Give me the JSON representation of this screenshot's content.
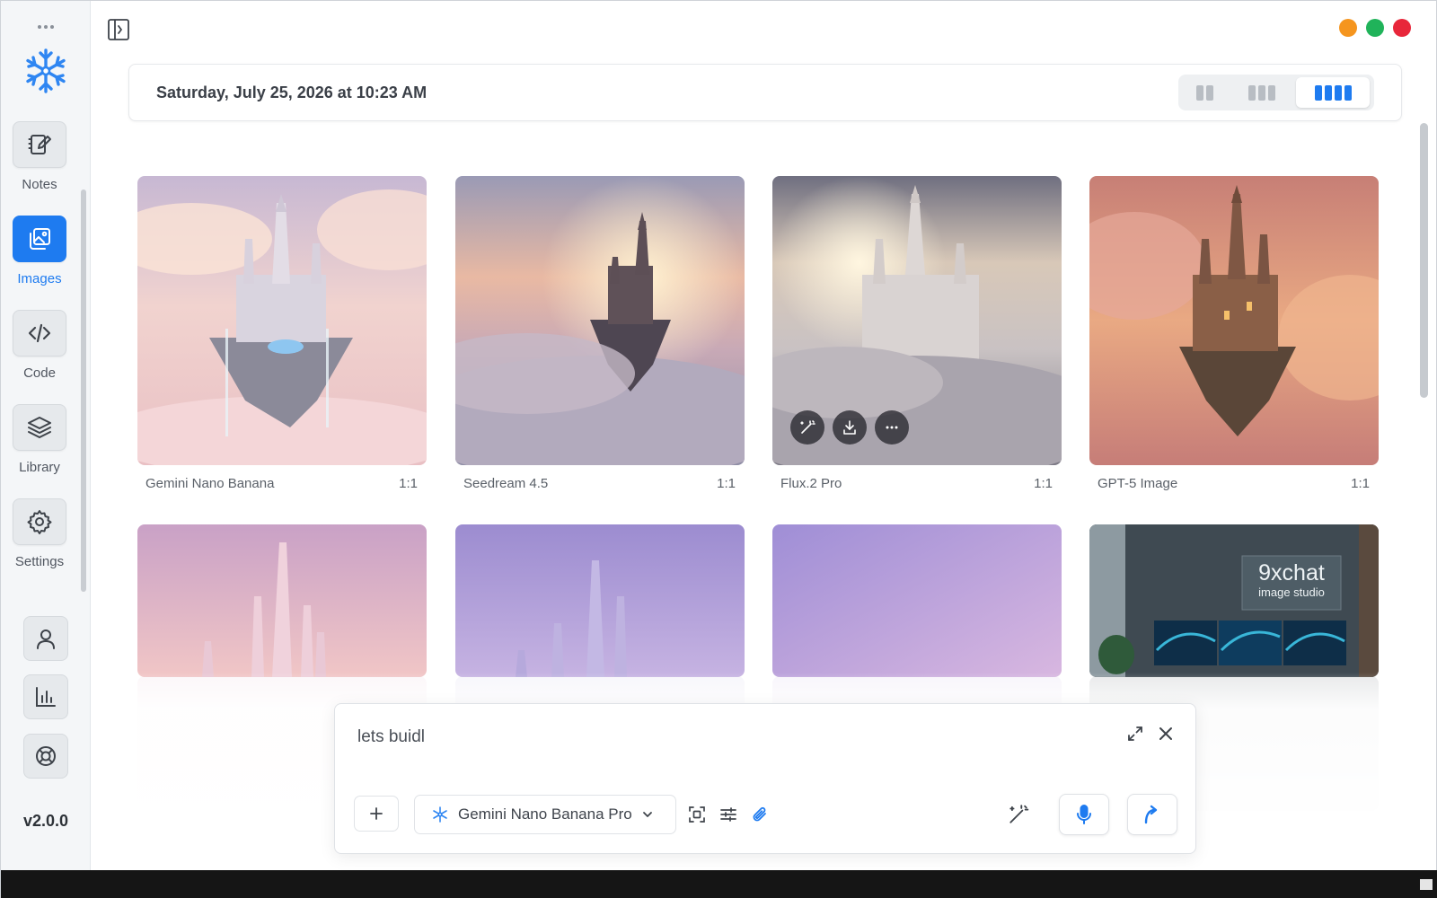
{
  "sidebar": {
    "items": [
      {
        "label": "Notes",
        "icon": "notes-icon",
        "active": false
      },
      {
        "label": "Images",
        "icon": "images-icon",
        "active": true
      },
      {
        "label": "Code",
        "icon": "code-icon",
        "active": false
      },
      {
        "label": "Library",
        "icon": "layers-icon",
        "active": false
      },
      {
        "label": "Settings",
        "icon": "gear-icon",
        "active": false
      }
    ],
    "utilities": [
      "user-icon",
      "chart-icon",
      "lifebuoy-icon"
    ],
    "version": "v2.0.0"
  },
  "header": {
    "date": "Saturday, July 25, 2026 at 10:23 AM",
    "layout_options": [
      "2-column",
      "3-column",
      "4-column"
    ],
    "selected_layout": "4-column"
  },
  "window_controls": {
    "colors": [
      "#f5951e",
      "#20b35a",
      "#e8263a"
    ]
  },
  "gallery": {
    "row1": [
      {
        "model": "Gemini Nano Banana",
        "ratio": "1:1"
      },
      {
        "model": "Seedream 4.5",
        "ratio": "1:1"
      },
      {
        "model": "Flux.2 Pro",
        "ratio": "1:1"
      },
      {
        "model": "GPT-5 Image",
        "ratio": "1:1"
      }
    ],
    "row2_sign": {
      "title": "9xchat",
      "subtitle": "image studio"
    },
    "hover_actions": [
      "magic-wand-icon",
      "download-icon",
      "more-icon"
    ]
  },
  "composer": {
    "text": "lets buidl",
    "model": "Gemini Nano Banana Pro"
  },
  "colors": {
    "accent": "#1e7bf0"
  }
}
